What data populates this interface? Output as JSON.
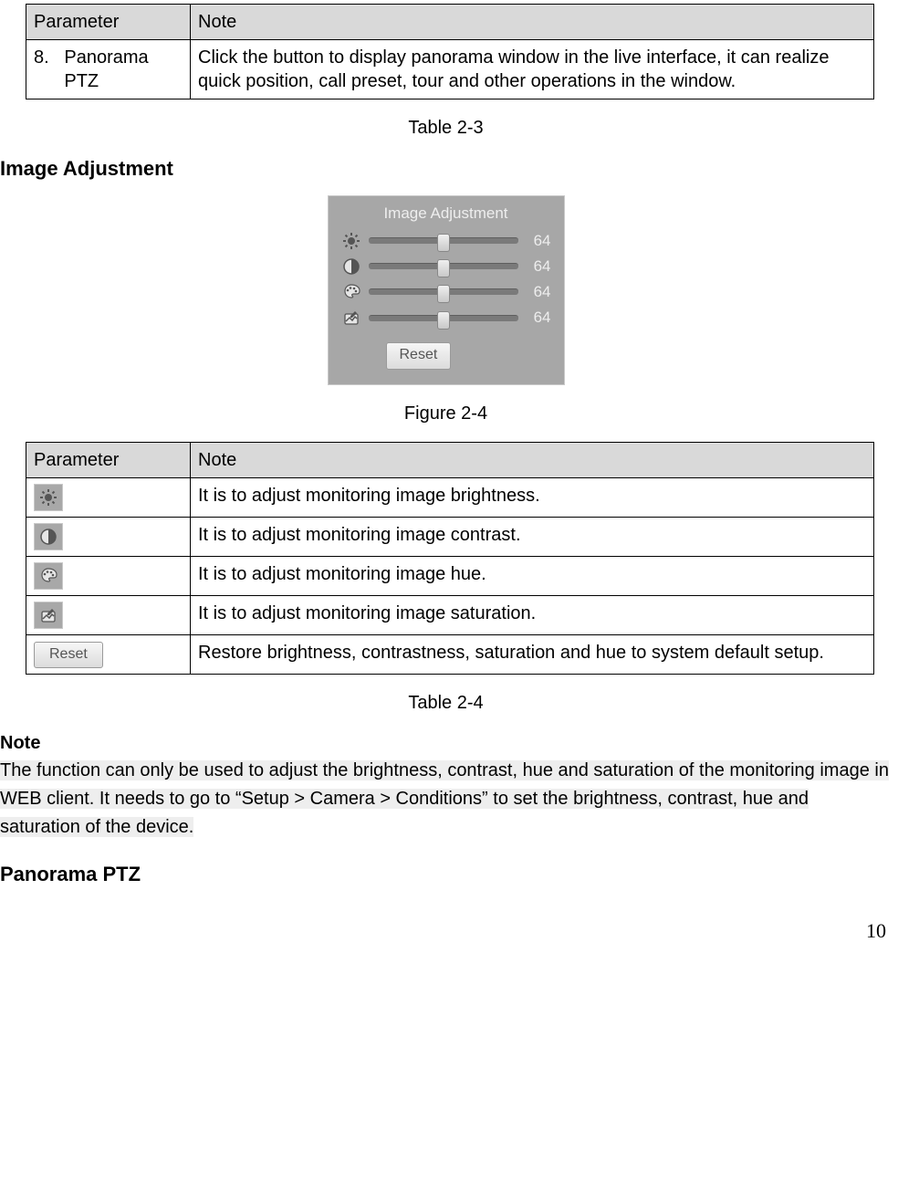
{
  "table23": {
    "headers": {
      "param": "Parameter",
      "note": "Note"
    },
    "row": {
      "num": "8.",
      "name": "Panorama PTZ",
      "note": "Click the button to display panorama window in the live interface, it can realize quick position, call preset, tour and other operations in the window."
    },
    "caption": "Table 2-3"
  },
  "section_image_adjust": "Image Adjustment",
  "panel": {
    "title": "Image Adjustment",
    "sliders": [
      {
        "icon": "brightness",
        "value": "64"
      },
      {
        "icon": "contrast",
        "value": "64"
      },
      {
        "icon": "hue",
        "value": "64"
      },
      {
        "icon": "saturation",
        "value": "64"
      }
    ],
    "reset": "Reset"
  },
  "figure_caption": "Figure 2-4",
  "table24": {
    "headers": {
      "param": "Parameter",
      "note": "Note"
    },
    "rows": [
      {
        "icon": "brightness",
        "note": "It is to adjust monitoring image brightness."
      },
      {
        "icon": "contrast",
        "note": "It is to adjust monitoring image contrast."
      },
      {
        "icon": "hue",
        "note": "It is to adjust monitoring image hue."
      },
      {
        "icon": "saturation",
        "note": "It is to adjust monitoring image saturation."
      },
      {
        "icon": "reset",
        "note": "Restore brightness, contrastness, saturation and hue to system default setup."
      }
    ],
    "reset_label": "Reset",
    "caption": "Table 2-4"
  },
  "note": {
    "heading": "Note",
    "body": "The function can only be used to adjust the brightness, contrast, hue and saturation of the monitoring image in WEB client. It needs to go to “Setup > Camera > Conditions” to set the brightness, contrast, hue and saturation of the device."
  },
  "section_panorama": "Panorama PTZ",
  "page_number": "10"
}
